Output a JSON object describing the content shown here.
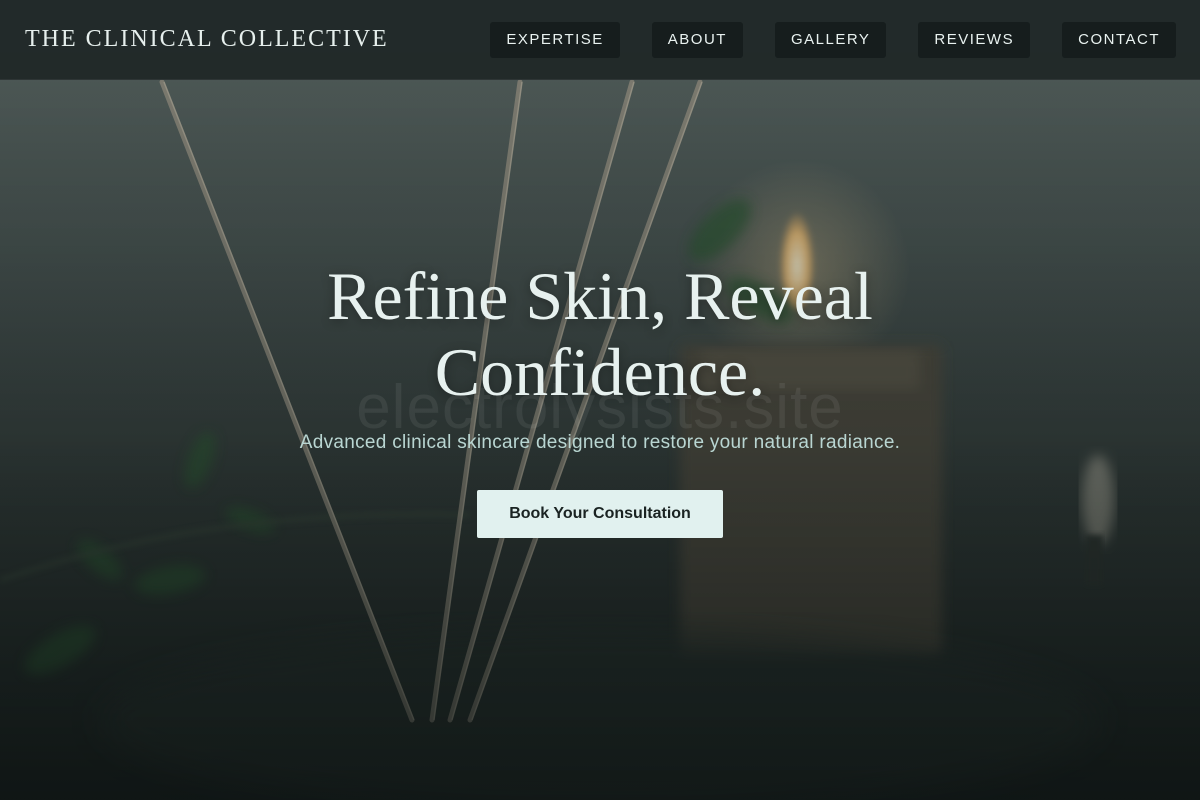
{
  "brand": {
    "name": "THE CLINICAL COLLECTIVE"
  },
  "nav": {
    "items": [
      {
        "label": "EXPERTISE"
      },
      {
        "label": "ABOUT"
      },
      {
        "label": "GALLERY"
      },
      {
        "label": "REVIEWS"
      },
      {
        "label": "CONTACT"
      }
    ]
  },
  "hero": {
    "title_line1": "Refine Skin, Reveal",
    "title_line2": "Confidence.",
    "subtitle": "Advanced clinical skincare designed to restore your natural radiance.",
    "cta_label": "Book Your Consultation",
    "watermark": "electrolysists.site"
  },
  "colors": {
    "header_bg": "#1e2626",
    "nav_button_bg": "#161d1d",
    "title_text": "#e7f1ef",
    "subtitle_text": "#b9d6d2",
    "cta_bg": "#e1f1ef",
    "cta_text": "#1a2322"
  },
  "background": {
    "description_icon": "spa-reed-diffuser-candle-photo"
  }
}
